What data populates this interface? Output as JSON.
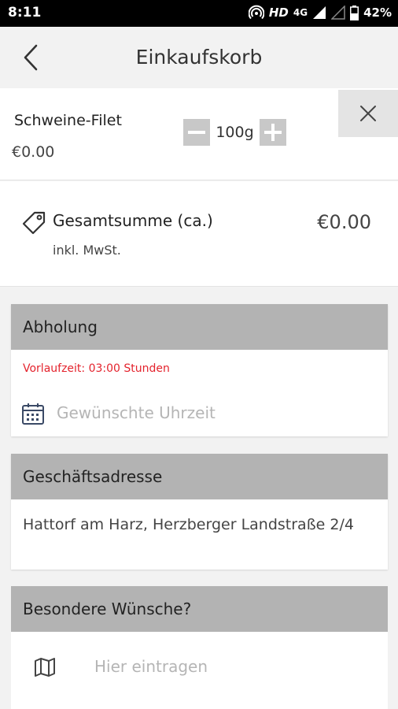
{
  "status_bar": {
    "time": "8:11",
    "network": "HD",
    "network_type": "4G",
    "battery": "42%"
  },
  "header": {
    "title": "Einkaufskorb",
    "back_icon": "chevron-left-icon"
  },
  "cart_item": {
    "name": "Schweine-Filet",
    "price": "€0.00",
    "quantity": "100g",
    "remove_icon": "close-icon"
  },
  "total": {
    "label": "Gesamtsumme (ca.)",
    "sublabel": "inkl. MwSt.",
    "value": "€0.00",
    "icon": "price-tag-icon"
  },
  "pickup": {
    "header": "Abholung",
    "lead_time": "Vorlaufzeit: 03:00 Stunden",
    "time_placeholder": "Gewünschte Uhrzeit",
    "icon": "calendar-icon",
    "lead_color": "#e4232d"
  },
  "address": {
    "header": "Geschäftsadresse",
    "text": "Hattorf am Harz, Herzberger Landstraße 2/4"
  },
  "wishes": {
    "header": "Besondere Wünsche?",
    "placeholder": "Hier eintragen",
    "icon": "map-icon"
  },
  "colors": {
    "section_header": "#b3b3b3",
    "background": "#f2f2f2",
    "accent_red": "#e4232d"
  }
}
